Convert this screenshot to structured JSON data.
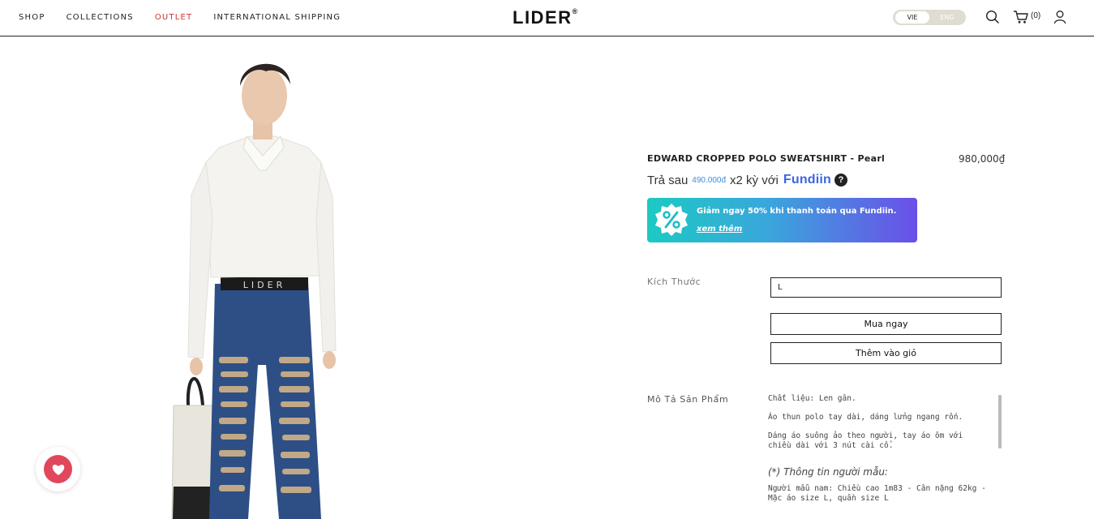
{
  "header": {
    "nav": [
      {
        "label": "SHOP",
        "color": "#222222"
      },
      {
        "label": "COLLECTIONS",
        "color": "#222222"
      },
      {
        "label": "OUTLET",
        "color": "#d0312d"
      },
      {
        "label": "INTERNATIONAL SHIPPING",
        "color": "#222222"
      }
    ],
    "logo": "LIDER",
    "logo_mark": "®",
    "lang": {
      "selected": "VIE",
      "other": "ENG"
    },
    "icons": [
      "search-icon",
      "cart-icon",
      "user-icon"
    ],
    "cart_count": "(0)"
  },
  "product": {
    "title": "EDWARD CROPPED POLO SWEATSHIRT - Pearl",
    "price": "980,000₫",
    "installment": {
      "prefix": "Trả sau",
      "amount": "490.000đ",
      "suffix": "x2 kỳ với",
      "brand": "Fundiin"
    },
    "promo": {
      "text": "Giảm ngay 50% khi thanh toán qua Fundiin.",
      "link": "xem thêm",
      "icon": "percent-badge-icon"
    },
    "size": {
      "label": "Kích Thước",
      "value": "L"
    },
    "buttons": {
      "buy_now": "Mua ngay",
      "add_to_cart": "Thêm vào giỏ"
    },
    "description": {
      "label": "Mô Tả Sản Phẩm",
      "lines": [
        "Chất liệu: Len gân.",
        "Áo thun polo tay dài, dáng lửng ngang rốn.",
        "Dáng áo suông ảo theo người, tay áo ôm với chiều dài với 3 nút cài cổ."
      ],
      "model_title": "(*) Thông tin người mẫu:",
      "model_info": "Người mẫu nam: Chiều cao 1m83 - Cân nặng 62kg - Mặc áo size L, quần size L"
    },
    "image_waistband_text": "LIDER"
  },
  "wishlist": {
    "icon": "heart-icon"
  }
}
